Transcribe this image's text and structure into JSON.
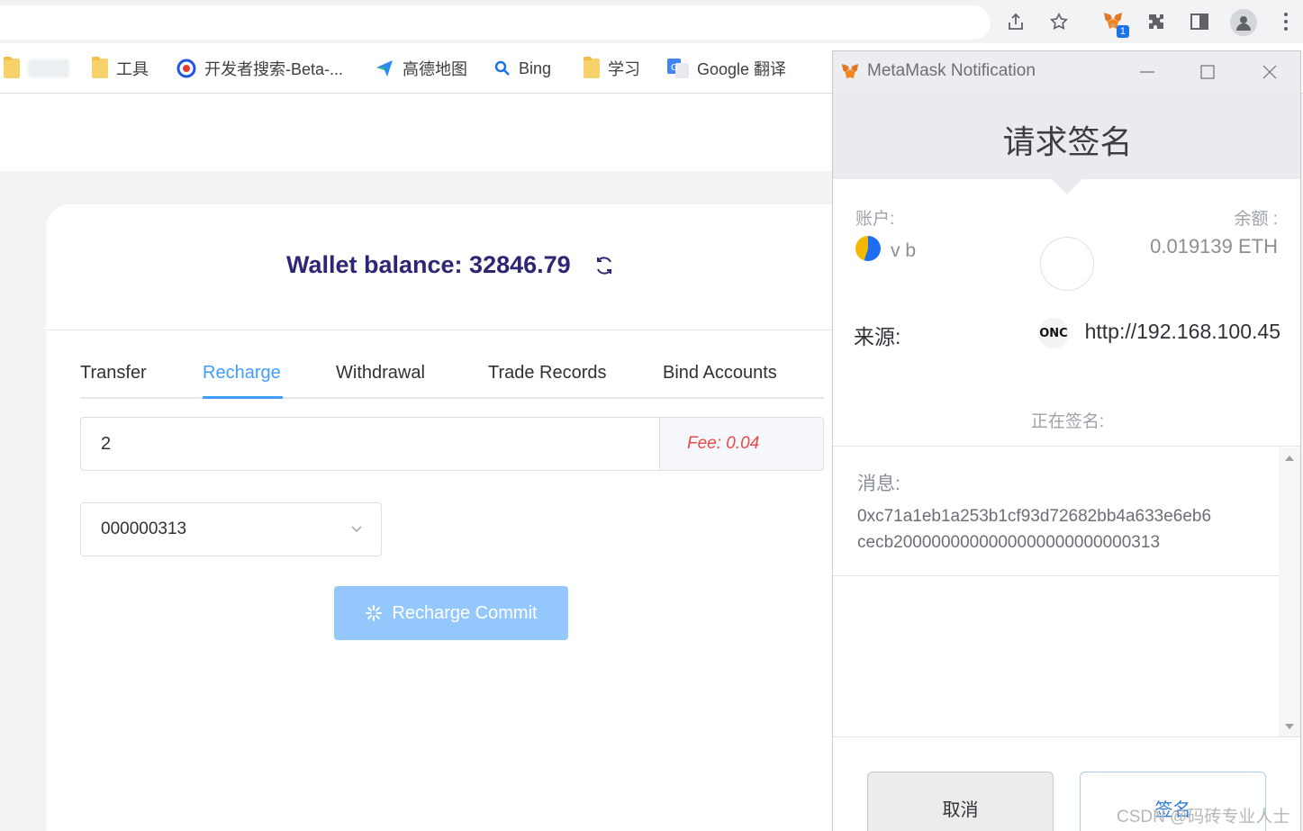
{
  "browser": {
    "bookmarks": [
      {
        "label": "",
        "icon": "folder-icon"
      },
      {
        "label": "工具",
        "icon": "folder-icon"
      },
      {
        "label": "开发者搜索-Beta-...",
        "icon": "dev-search-icon"
      },
      {
        "label": "高德地图",
        "icon": "amap-icon"
      },
      {
        "label": "Bing",
        "icon": "search-icon"
      },
      {
        "label": "学习",
        "icon": "folder-icon"
      },
      {
        "label": "Google 翻译",
        "icon": "google-translate-icon"
      }
    ],
    "extension_badge": "1"
  },
  "wallet": {
    "balance_label": "Wallet balance: 32846.79",
    "tabs": [
      "Transfer",
      "Recharge",
      "Withdrawal",
      "Trade Records",
      "Bind Accounts"
    ],
    "active_tab": "Recharge",
    "amount_value": "2",
    "fee": "Fee: 0.04",
    "account_select": "000000313",
    "commit_label": "Recharge Commit",
    "accent": "#409eff",
    "balance_color": "#2c2675"
  },
  "metamask": {
    "window_title": "MetaMask Notification",
    "header": "请求签名",
    "account_label": "账户:",
    "account_name": "v    b",
    "balance_label": "余额 :",
    "balance_value": "0.019139 ETH",
    "origin_label": "来源:",
    "origin_badge": "ONC",
    "origin_url": "http://192.168.100.45",
    "signing_label": "正在签名:",
    "message_label": "消息:",
    "message_line1": "0xc71a1eb1a253b1cf93d72682bb4a633e6eb6",
    "message_line2": "cecb2000000000000000000000000313",
    "cancel_label": "取消",
    "sign_label": "签名"
  },
  "watermark": "CSDN @码砖专业人士"
}
